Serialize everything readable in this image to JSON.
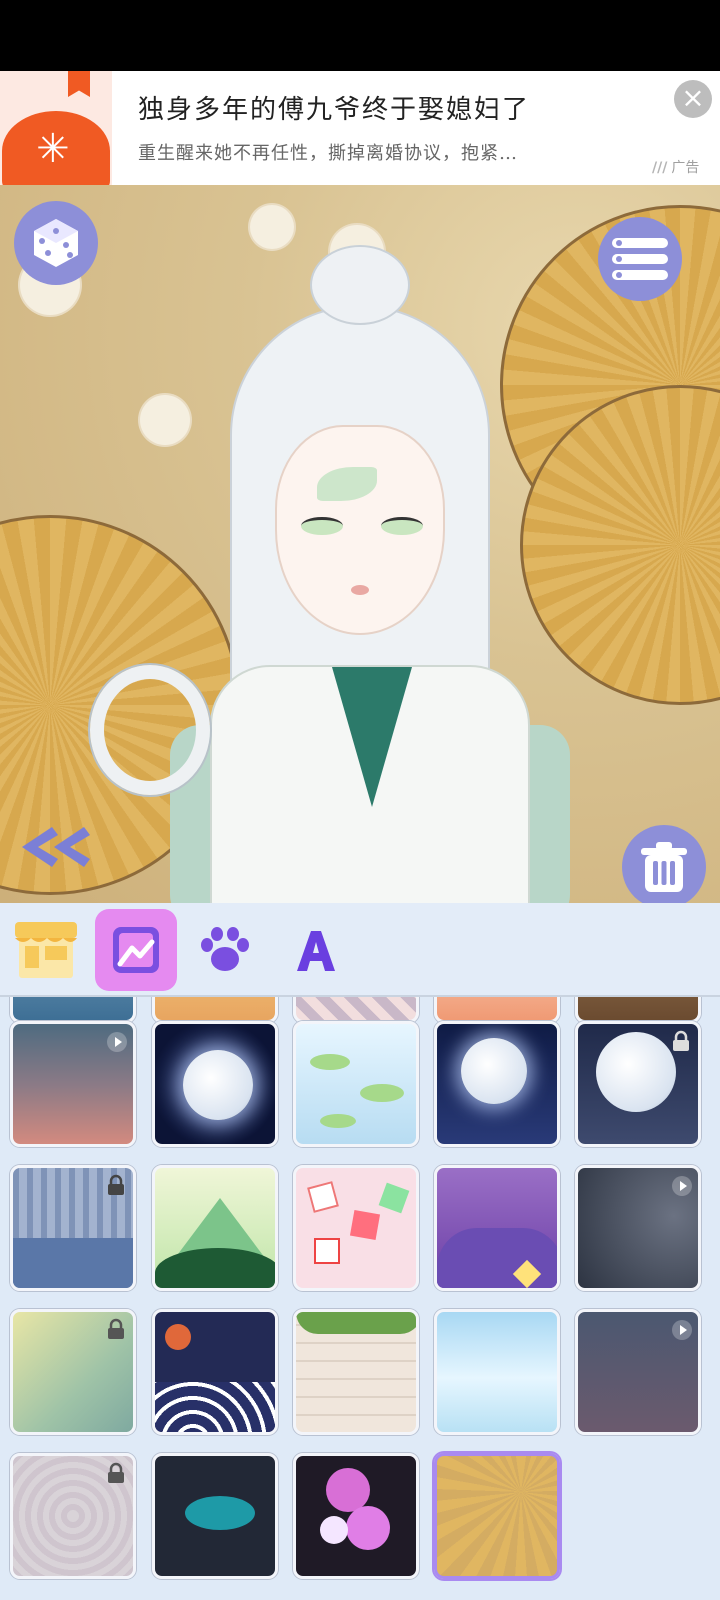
{
  "ad": {
    "title": "独身多年的傅九爷终于娶媳妇了",
    "description": "重生醒来她不再任性，撕掉离婚协议，抱紧…",
    "tag": "广告",
    "close_icon": "close-icon"
  },
  "canvas": {
    "buttons": [
      "dice-icon",
      "list-menu-icon",
      "double-chevron-left-icon",
      "trash-icon"
    ]
  },
  "tabs": [
    {
      "name": "shop-icon",
      "active": false
    },
    {
      "name": "background-image-icon",
      "active": true
    },
    {
      "name": "paw-icon",
      "active": false
    },
    {
      "name": "text-a-icon",
      "active": false
    }
  ],
  "colors": {
    "accent": "#8d8fd8",
    "tab_active": "#e58af0",
    "selected_border": "#a98af0",
    "panel_bg": "#dfeaf7"
  },
  "backgrounds": [
    {
      "id": "sunset-haze",
      "locked": false,
      "video": true
    },
    {
      "id": "full-moon-dark",
      "locked": false,
      "video": false
    },
    {
      "id": "lily-pond",
      "locked": false,
      "video": false
    },
    {
      "id": "moon-starry-night",
      "locked": false,
      "video": false
    },
    {
      "id": "moon-snow-night",
      "locked": true,
      "video": false
    },
    {
      "id": "blue-forest",
      "locked": true,
      "video": false
    },
    {
      "id": "green-mountain",
      "locked": false,
      "video": false
    },
    {
      "id": "pink-dice-pattern",
      "locked": false,
      "video": false
    },
    {
      "id": "purple-clouds",
      "locked": false,
      "video": false
    },
    {
      "id": "spider-web",
      "locked": false,
      "video": true
    },
    {
      "id": "jade-dragon",
      "locked": true,
      "video": false
    },
    {
      "id": "night-waves",
      "locked": false,
      "video": false
    },
    {
      "id": "brick-wall-ivy",
      "locked": false,
      "video": false
    },
    {
      "id": "sky-clouds",
      "locked": false,
      "video": false
    },
    {
      "id": "dusk-crescent",
      "locked": false,
      "video": true
    },
    {
      "id": "gray-swirl",
      "locked": true,
      "video": false
    },
    {
      "id": "teal-splatter",
      "locked": false,
      "video": false
    },
    {
      "id": "pink-bubbles",
      "locked": false,
      "video": false
    },
    {
      "id": "golden-fans",
      "locked": false,
      "video": false,
      "selected": true
    }
  ]
}
